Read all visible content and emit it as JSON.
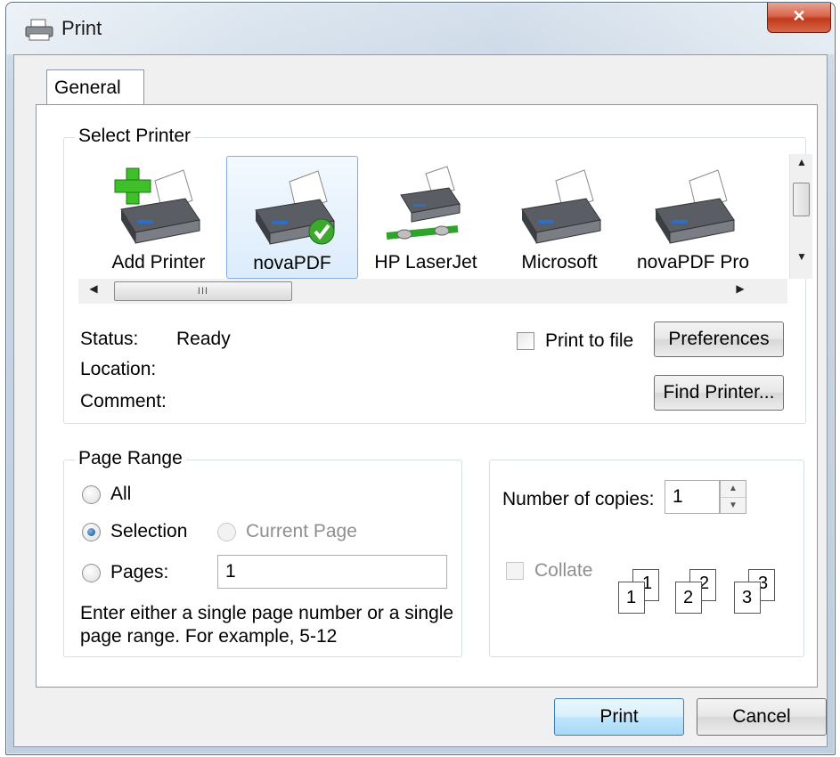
{
  "window": {
    "title": "Print",
    "close_glyph": "✕"
  },
  "tabs": [
    {
      "label": "General"
    }
  ],
  "select_printer": {
    "group_label": "Select Printer",
    "printers": [
      {
        "label": "Add Printer",
        "icon": "add-printer-icon"
      },
      {
        "label": "novaPDF",
        "icon": "printer-default-icon",
        "selected": true
      },
      {
        "label": "HP LaserJet",
        "icon": "network-printer-icon"
      },
      {
        "label": "Microsoft",
        "icon": "printer-icon"
      },
      {
        "label": "novaPDF Pro",
        "icon": "printer-icon"
      }
    ],
    "scroll_thumb_glyph": "III",
    "status_label": "Status:",
    "status_value": "Ready",
    "location_label": "Location:",
    "location_value": "",
    "comment_label": "Comment:",
    "comment_value": "",
    "print_to_file_label": "Print to file",
    "preferences_label": "Preferences",
    "find_printer_label": "Find Printer..."
  },
  "page_range": {
    "group_label": "Page Range",
    "all_label": "All",
    "selection_label": "Selection",
    "current_page_label": "Current Page",
    "pages_label": "Pages:",
    "pages_value": "1",
    "help_line1": "Enter either a single page number or a single",
    "help_line2": "page range.  For example, 5-12",
    "selected_option": "Selection"
  },
  "copies": {
    "label": "Number of copies:",
    "value": "1",
    "collate_label": "Collate",
    "collate_checked": false,
    "collate_pages": [
      {
        "back": "1",
        "front": "1"
      },
      {
        "back": "2",
        "front": "2"
      },
      {
        "back": "3",
        "front": "3"
      }
    ]
  },
  "footer": {
    "print_label": "Print",
    "cancel_label": "Cancel"
  },
  "colors": {
    "accent": "#3c7fb1",
    "selected_bg": "#dcecfc",
    "close_red": "#c1391b"
  }
}
